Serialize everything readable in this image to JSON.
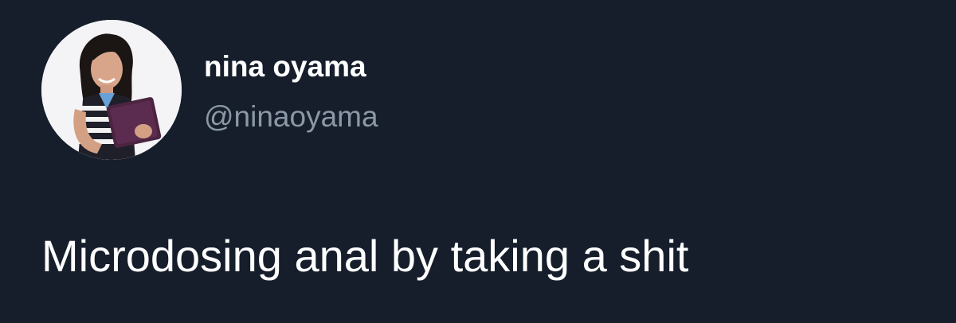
{
  "tweet": {
    "author": {
      "display_name": "nina oyama",
      "handle": "@ninaoyama",
      "avatar_icon": "profile-photo"
    },
    "text": "Microdosing anal by taking a shit"
  },
  "colors": {
    "background": "#161e2c",
    "name_text": "#ffffff",
    "handle_text": "#8b98a5",
    "body_text": "#ffffff"
  }
}
